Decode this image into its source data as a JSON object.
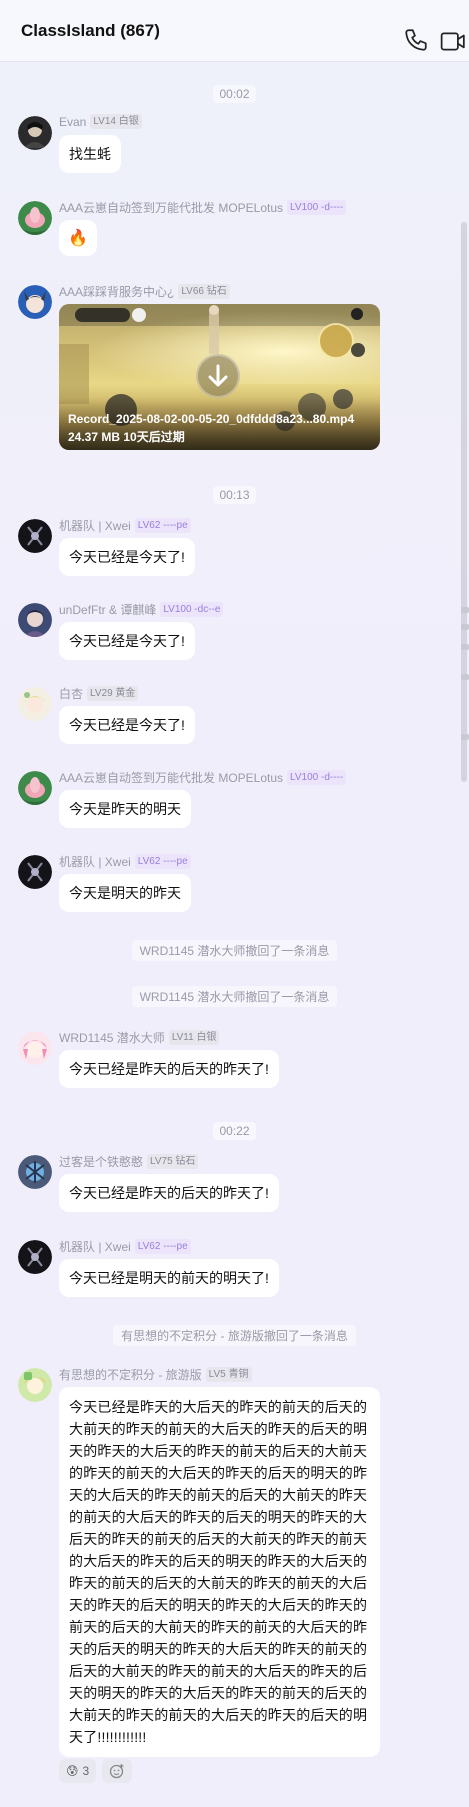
{
  "header": {
    "title": "ClassIsland (867)"
  },
  "timestamps": [
    "00:02",
    "00:13",
    "00:22"
  ],
  "messages": [
    {
      "sender": "Evan",
      "badge": "LV14 白银",
      "text": "找生蚝"
    },
    {
      "sender": "AAA云崽自动签到万能代批发 MOPELotus",
      "badge": "LV100 -d----",
      "text": "🔥"
    },
    {
      "sender": "AAA踩踩背服务中心¿",
      "badge": "LV66 钻石",
      "file": {
        "name": "Record_2025-08-02-00-05-20_0dfddd8a23...80.mp4",
        "meta": "24.37 MB 10天后过期"
      }
    },
    {
      "sender": "机器队 | Xwei",
      "badge": "LV62 ----pe",
      "text": "今天已经是今天了!"
    },
    {
      "sender": "unDefFtr & 谭麒峰",
      "badge": "LV100 -dc--e",
      "text": "今天已经是今天了!"
    },
    {
      "sender": "白杏",
      "badge": "LV29 黄金",
      "text": "今天已经是今天了!"
    },
    {
      "sender": "AAA云崽自动签到万能代批发 MOPELotus",
      "badge": "LV100 -d----",
      "text": "今天是昨天的明天"
    },
    {
      "sender": "机器队 | Xwei",
      "badge": "LV62 ----pe",
      "text": "今天是明天的昨天"
    },
    {
      "sender": "WRD1145 潜水大师",
      "badge": "LV11 白银",
      "text": "今天已经是昨天的后天的昨天了!"
    },
    {
      "sender": "过客是个铁憨憨",
      "badge": "LV75 钻石",
      "text": "今天已经是昨天的后天的昨天了!"
    },
    {
      "sender": "机器队 | Xwei",
      "badge": "LV62 ----pe",
      "text": "今天已经是明天的前天的明天了!"
    },
    {
      "sender": "有思想的不定积分 - 旅游版",
      "badge": "LV5 青铜",
      "text": "今天已经是昨天的大后天的昨天的前天的后天的大前天的昨天的前天的大后天的昨天的后天的明天的昨天的大后天的昨天的前天的后天的大前天的昨天的前天的大后天的昨天的后天的明天的昨天的大后天的昨天的前天的后天的大前天的昨天的前天的大后天的昨天的后天的明天的昨天的大后天的昨天的前天的后天的大前天的昨天的前天的大后天的昨天的后天的明天的昨天的大后天的昨天的前天的后天的大前天的昨天的前天的大后天的昨天的后天的明天的昨天的大后天的昨天的前天的后天的大前天的昨天的前天的大后天的昨天的后天的明天的昨天的大后天的昨天的前天的后天的大前天的昨天的前天的大后天的昨天的后天的明天的昨天的大后天的昨天的前天的后天的大前天的昨天的前天的大后天的昨天的后天的明天了!!!!!!!!!!!!"
    }
  ],
  "notices": [
    "WRD1145 潜水大师撤回了一条消息",
    "WRD1145 潜水大师撤回了一条消息",
    "有思想的不定积分 - 旅游版撤回了一条消息"
  ],
  "reactions": [
    {
      "emoji": "😰",
      "count": "3"
    }
  ],
  "icons": {
    "phone": "phone-icon",
    "video": "video-call-icon",
    "download": "download-icon",
    "add_reaction": "add-reaction-icon"
  }
}
